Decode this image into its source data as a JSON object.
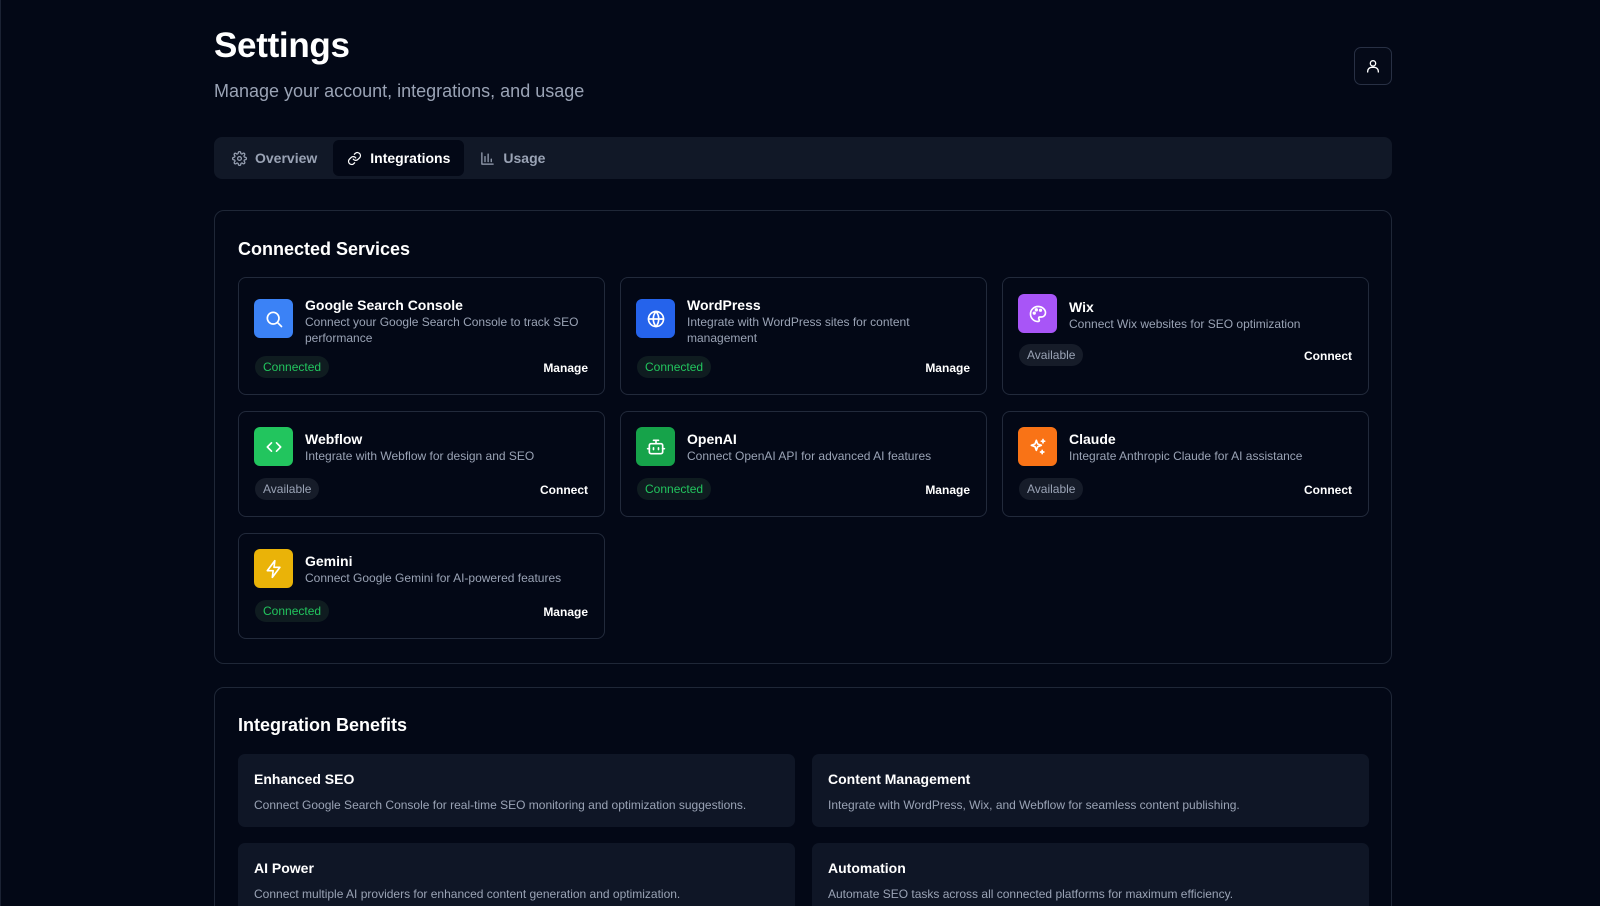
{
  "header": {
    "title": "Settings",
    "subtitle": "Manage your account, integrations, and usage"
  },
  "tabs": [
    {
      "label": "Overview",
      "icon": "gear-icon",
      "active": false
    },
    {
      "label": "Integrations",
      "icon": "link-icon",
      "active": true
    },
    {
      "label": "Usage",
      "icon": "bar-chart-icon",
      "active": false
    }
  ],
  "connected_services": {
    "title": "Connected Services",
    "services": [
      {
        "name": "Google Search Console",
        "description": "Connect your Google Search Console to track SEO performance",
        "status": "Connected",
        "action": "Manage",
        "icon": "search-icon",
        "color": "#3b82f6"
      },
      {
        "name": "WordPress",
        "description": "Integrate with WordPress sites for content management",
        "status": "Connected",
        "action": "Manage",
        "icon": "globe-icon",
        "color": "#2563eb"
      },
      {
        "name": "Wix",
        "description": "Connect Wix websites for SEO optimization",
        "status": "Available",
        "action": "Connect",
        "icon": "palette-icon",
        "color": "#a855f7"
      },
      {
        "name": "Webflow",
        "description": "Integrate with Webflow for design and SEO",
        "status": "Available",
        "action": "Connect",
        "icon": "code-icon",
        "color": "#22c55e"
      },
      {
        "name": "OpenAI",
        "description": "Connect OpenAI API for advanced AI features",
        "status": "Connected",
        "action": "Manage",
        "icon": "bot-icon",
        "color": "#16a34a"
      },
      {
        "name": "Claude",
        "description": "Integrate Anthropic Claude for AI assistance",
        "status": "Available",
        "action": "Connect",
        "icon": "sparkles-icon",
        "color": "#f97316"
      },
      {
        "name": "Gemini",
        "description": "Connect Google Gemini for AI-powered features",
        "status": "Connected",
        "action": "Manage",
        "icon": "zap-icon",
        "color": "#eab308"
      }
    ]
  },
  "benefits": {
    "title": "Integration Benefits",
    "items": [
      {
        "title": "Enhanced SEO",
        "description": "Connect Google Search Console for real-time SEO monitoring and optimization suggestions."
      },
      {
        "title": "Content Management",
        "description": "Integrate with WordPress, Wix, and Webflow for seamless content publishing."
      },
      {
        "title": "AI Power",
        "description": "Connect multiple AI providers for enhanced content generation and optimization."
      },
      {
        "title": "Automation",
        "description": "Automate SEO tasks across all connected platforms for maximum efficiency."
      }
    ]
  },
  "colors": {
    "background": "#030816",
    "surface": "#111827",
    "connected": "#22c55e",
    "muted_text": "#9aa3b5"
  }
}
